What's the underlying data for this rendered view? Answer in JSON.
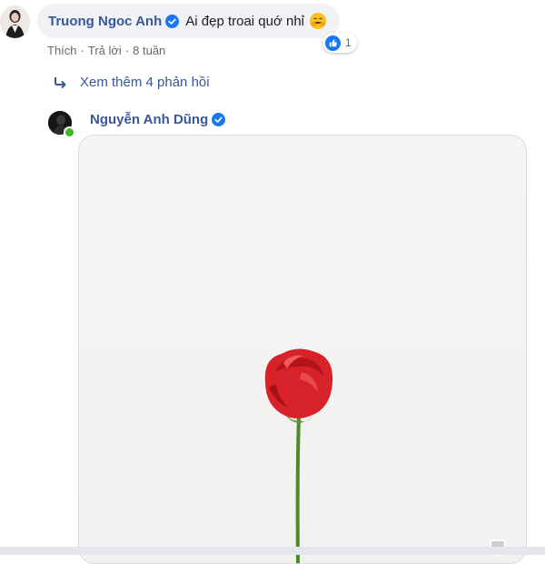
{
  "comment": {
    "author": "Truong Ngoc Anh",
    "text": "Ai đẹp troai quớ nhỉ",
    "emoji_icon": "blushing-hug-emoji",
    "reaction_count": "1",
    "actions": {
      "like": "Thích",
      "reply": "Trả lời",
      "time": "8 tuần"
    }
  },
  "view_more_replies": "Xem thêm 4 phản hồi",
  "reply": {
    "author": "Nguyễn Anh Dũng",
    "attachment": "rose-gif"
  },
  "colors": {
    "link_blue": "#385898",
    "bubble_bg": "#f0f2f5",
    "meta_gray": "#65676b",
    "verified_blue": "#1877f2",
    "online_green": "#42b72a"
  }
}
